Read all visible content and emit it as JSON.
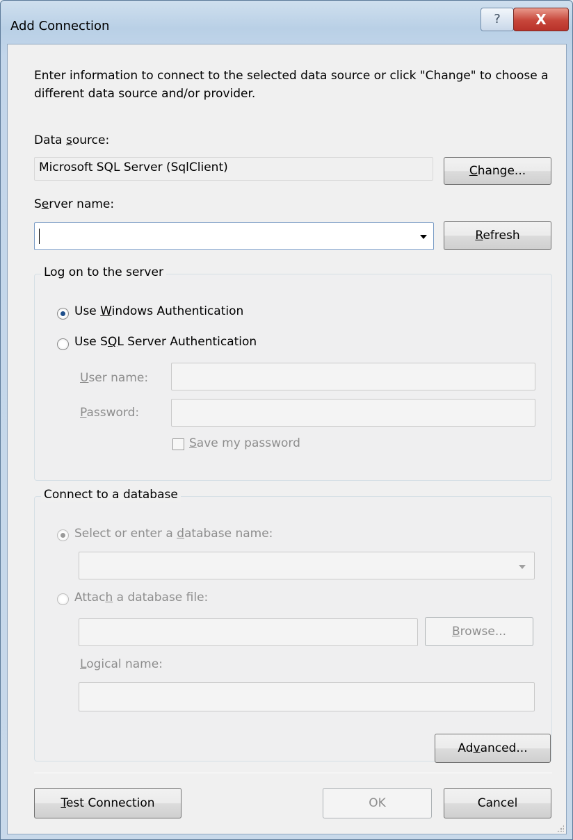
{
  "window": {
    "title": "Add Connection",
    "help_glyph": "?",
    "close_glyph": "X"
  },
  "intro_text": "Enter information to connect to the selected data source or click \"Change\" to choose a different data source and/or provider.",
  "data_source": {
    "label_pre": "Data ",
    "label_key": "s",
    "label_post": "ource:",
    "value": "Microsoft SQL Server (SqlClient)",
    "change_key": "C",
    "change_rest": "hange..."
  },
  "server": {
    "label_pre": "S",
    "label_key": "e",
    "label_post": "rver name:",
    "value": "",
    "refresh_key": "R",
    "refresh_rest": "efresh"
  },
  "logon": {
    "legend": "Log on to the server",
    "windows_auth_pre": "Use ",
    "windows_auth_key": "W",
    "windows_auth_post": "indows Authentication",
    "sql_auth_pre": "Use S",
    "sql_auth_key": "Q",
    "sql_auth_post": "L Server Authentication",
    "selected": "windows",
    "username_key": "U",
    "username_rest": "ser name:",
    "password_key": "P",
    "password_rest": "assword:",
    "save_pw_key": "S",
    "save_pw_rest": "ave my password"
  },
  "database": {
    "legend": "Connect to a database",
    "select_pre": "Select or enter a ",
    "select_key": "d",
    "select_post": "atabase name:",
    "attach_pre": "Attac",
    "attach_key": "h",
    "attach_post": " a database file:",
    "browse_key": "B",
    "browse_rest": "rowse...",
    "logical_key": "L",
    "logical_rest": "ogical name:"
  },
  "buttons": {
    "advanced_pre": "Ad",
    "advanced_key": "v",
    "advanced_post": "anced...",
    "test_key": "T",
    "test_rest": "est Connection",
    "ok": "OK",
    "cancel": "Cancel"
  }
}
